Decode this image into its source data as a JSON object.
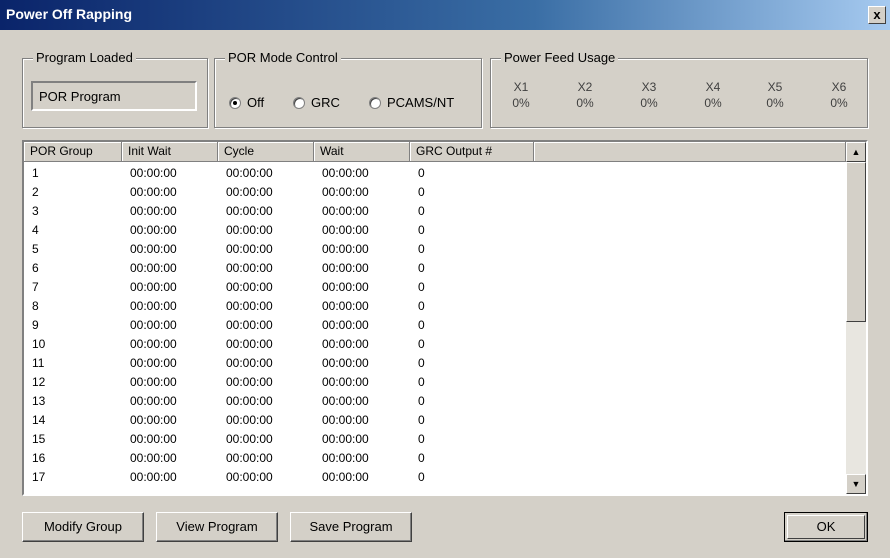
{
  "window": {
    "title": "Power Off Rapping",
    "close_label": "x"
  },
  "program_loaded": {
    "label": "Program Loaded",
    "value": "POR Program"
  },
  "mode_control": {
    "label": "POR Mode Control",
    "options": [
      {
        "label": "Off",
        "selected": true
      },
      {
        "label": "GRC",
        "selected": false
      },
      {
        "label": "PCAMS/NT",
        "selected": false
      }
    ]
  },
  "power_feed": {
    "label": "Power Feed Usage",
    "feeds": [
      {
        "name": "X1",
        "value": "0%"
      },
      {
        "name": "X2",
        "value": "0%"
      },
      {
        "name": "X3",
        "value": "0%"
      },
      {
        "name": "X4",
        "value": "0%"
      },
      {
        "name": "X5",
        "value": "0%"
      },
      {
        "name": "X6",
        "value": "0%"
      }
    ]
  },
  "table": {
    "columns": [
      "POR Group",
      "Init Wait",
      "Cycle",
      "Wait",
      "GRC Output #"
    ],
    "rows": [
      [
        "1",
        "00:00:00",
        "00:00:00",
        "00:00:00",
        "0"
      ],
      [
        "2",
        "00:00:00",
        "00:00:00",
        "00:00:00",
        "0"
      ],
      [
        "3",
        "00:00:00",
        "00:00:00",
        "00:00:00",
        "0"
      ],
      [
        "4",
        "00:00:00",
        "00:00:00",
        "00:00:00",
        "0"
      ],
      [
        "5",
        "00:00:00",
        "00:00:00",
        "00:00:00",
        "0"
      ],
      [
        "6",
        "00:00:00",
        "00:00:00",
        "00:00:00",
        "0"
      ],
      [
        "7",
        "00:00:00",
        "00:00:00",
        "00:00:00",
        "0"
      ],
      [
        "8",
        "00:00:00",
        "00:00:00",
        "00:00:00",
        "0"
      ],
      [
        "9",
        "00:00:00",
        "00:00:00",
        "00:00:00",
        "0"
      ],
      [
        "10",
        "00:00:00",
        "00:00:00",
        "00:00:00",
        "0"
      ],
      [
        "11",
        "00:00:00",
        "00:00:00",
        "00:00:00",
        "0"
      ],
      [
        "12",
        "00:00:00",
        "00:00:00",
        "00:00:00",
        "0"
      ],
      [
        "13",
        "00:00:00",
        "00:00:00",
        "00:00:00",
        "0"
      ],
      [
        "14",
        "00:00:00",
        "00:00:00",
        "00:00:00",
        "0"
      ],
      [
        "15",
        "00:00:00",
        "00:00:00",
        "00:00:00",
        "0"
      ],
      [
        "16",
        "00:00:00",
        "00:00:00",
        "00:00:00",
        "0"
      ],
      [
        "17",
        "00:00:00",
        "00:00:00",
        "00:00:00",
        "0"
      ]
    ]
  },
  "buttons": {
    "modify_group": "Modify Group",
    "view_program": "View Program",
    "save_program": "Save Program",
    "ok": "OK"
  }
}
